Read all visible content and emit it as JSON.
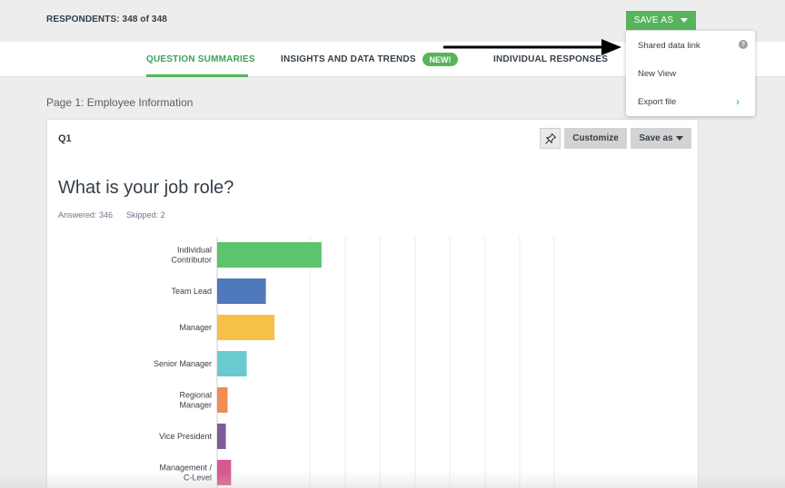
{
  "header": {
    "respondents": "RESPONDENTS: 348 of 348",
    "save_as_label": "SAVE AS"
  },
  "tabs": [
    {
      "label": "QUESTION SUMMARIES",
      "active": true
    },
    {
      "label": "INSIGHTS AND DATA TRENDS",
      "badge": "NEW!"
    },
    {
      "label": "INDIVIDUAL RESPONSES"
    }
  ],
  "page": {
    "title": "Page 1: Employee Information"
  },
  "question": {
    "number": "Q1",
    "title": "What is your job role?",
    "answered": "Answered: 346",
    "skipped": "Skipped: 2",
    "customize_label": "Customize",
    "save_as_label": "Save as"
  },
  "dropdown": {
    "items": [
      {
        "label": "Shared data link",
        "icon": "help-icon"
      },
      {
        "label": "New View"
      },
      {
        "label": "Export file",
        "icon": "chevron-right-icon"
      }
    ]
  },
  "colors": {
    "accent_green": "#57b45c",
    "text": "#333e48"
  },
  "chart_data": {
    "type": "bar",
    "orientation": "horizontal",
    "categories": [
      [
        "Individual",
        "Contributor"
      ],
      [
        "Team Lead"
      ],
      [
        "Manager"
      ],
      [
        "Senior Manager"
      ],
      [
        "Regional",
        "Manager"
      ],
      [
        "Vice President"
      ],
      [
        "Management /",
        "C-Level"
      ]
    ],
    "values": [
      30,
      14,
      16.5,
      8.5,
      3,
      2.5,
      4
    ],
    "colors": [
      "#5bc46d",
      "#4f79ba",
      "#f7c049",
      "#69cacf",
      "#f18d52",
      "#7f5b9b",
      "#d9588f"
    ],
    "xlim": [
      0,
      100
    ],
    "grid": true
  }
}
